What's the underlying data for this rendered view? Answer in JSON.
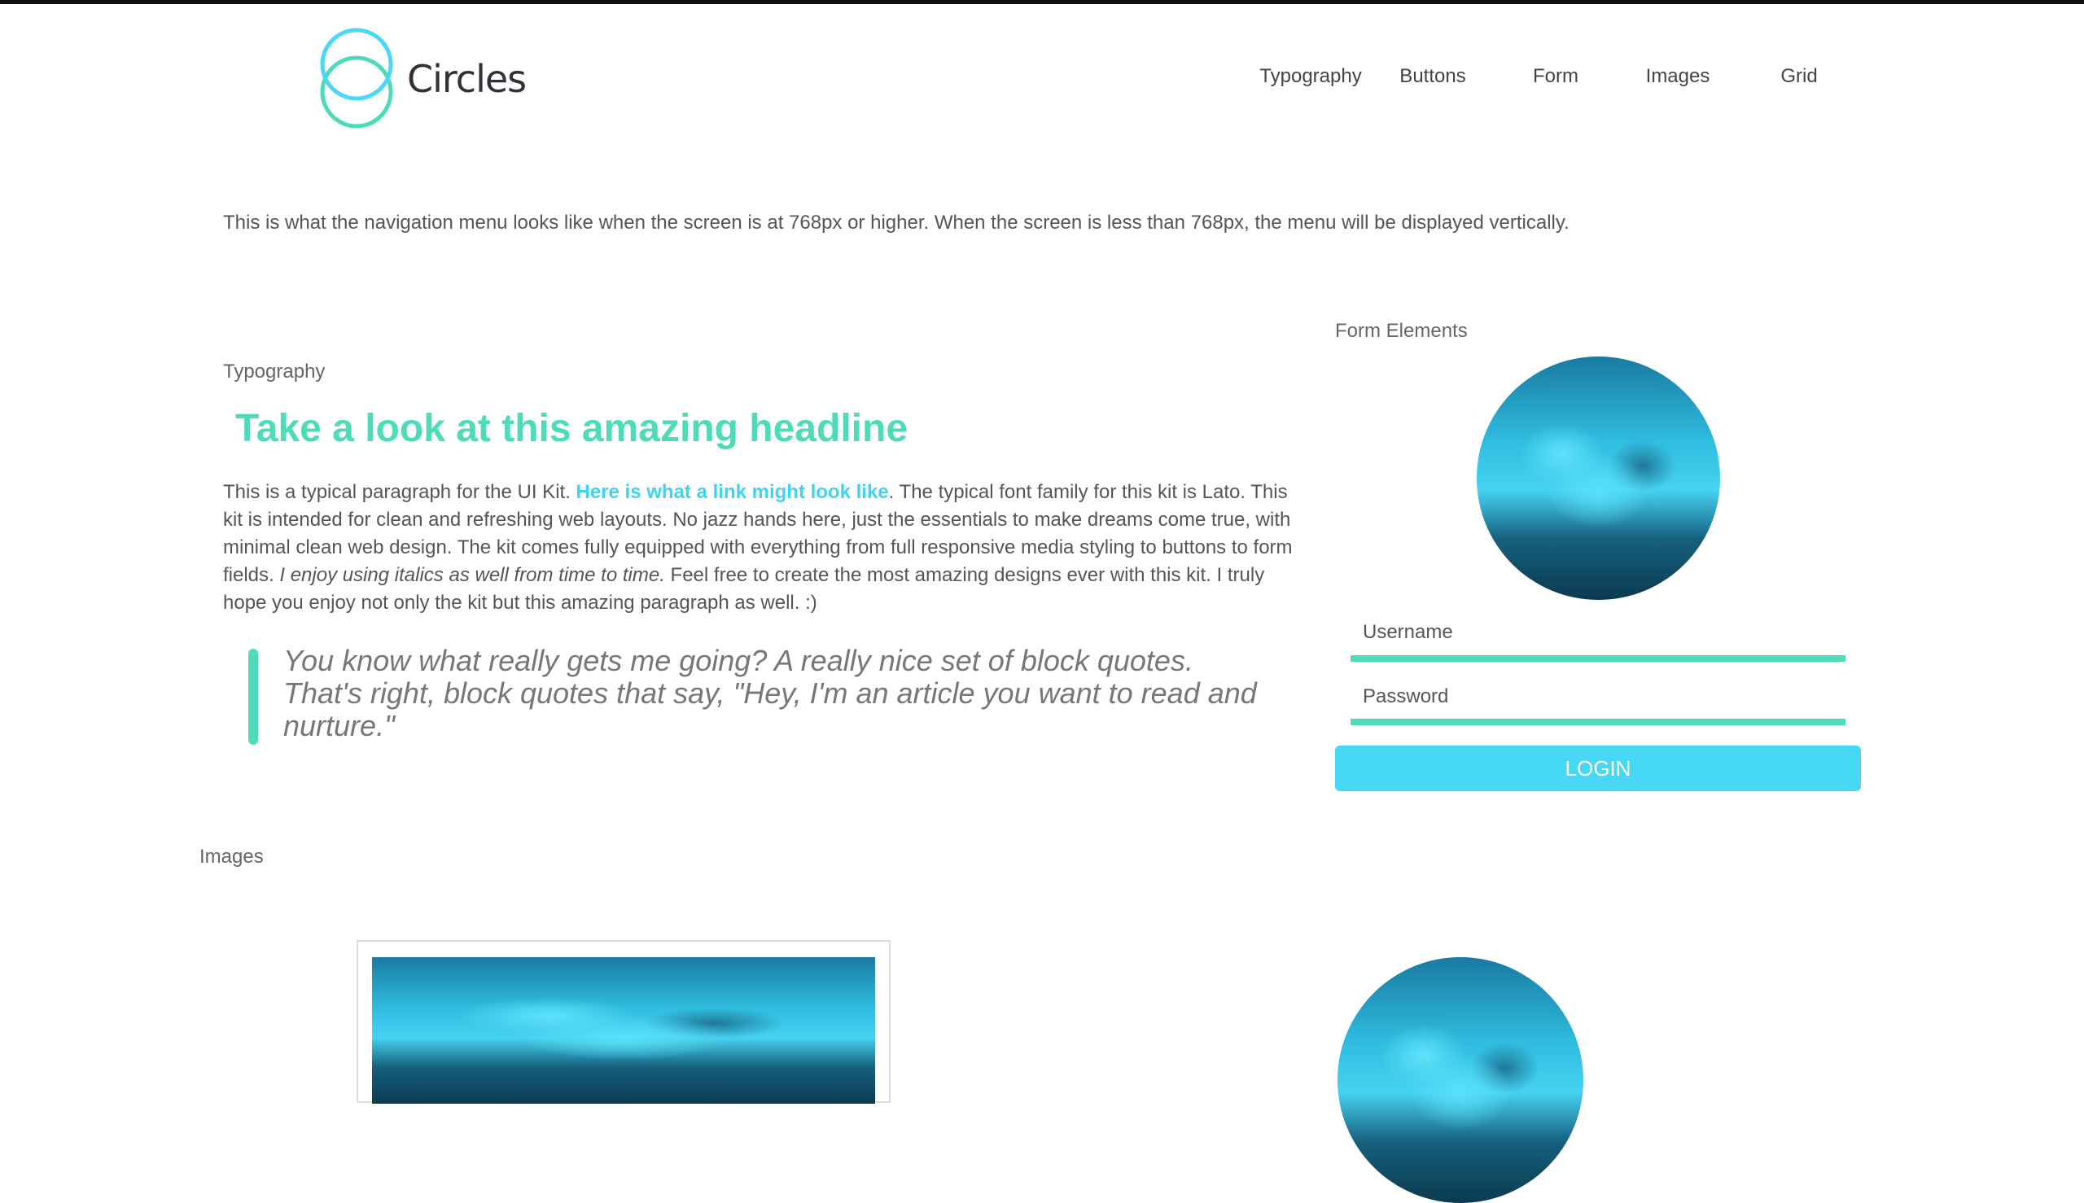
{
  "header": {
    "brand": "Circles",
    "colors": {
      "ring_top": "#4ad8f8",
      "ring_bottom": "#4ddbb9"
    },
    "nav": [
      "Typography",
      "Buttons",
      "Form",
      "Images",
      "Grid"
    ]
  },
  "intro": "This is what the navigation menu looks like when the screen is at 768px or higher. When the screen is less than 768px, the menu will be displayed vertically.",
  "typography": {
    "label": "Typography",
    "headline": "Take a look at this amazing headline",
    "para_1": "This is a typical paragraph for the UI Kit. ",
    "link": "Here is what a link might look like",
    "para_2": ". The typical font family for this kit is Lato. This kit is intended for clean and refreshing web layouts. No jazz hands here, just the essentials to make dreams come true, with minimal clean web design. The kit comes fully equipped with everything from full responsive media styling to buttons to form fields. ",
    "italic": "I enjoy using italics as well from time to time.",
    "para_3": " Feel free to create the most amazing designs ever with this kit. I truly hope you enjoy not only the kit but this amazing paragraph as well. :)",
    "blockquote": "You know what really gets me going? A really nice set of block quotes. That's right, block quotes that say, \"Hey, I'm an article you want to read and nurture.\""
  },
  "form": {
    "label": "Form Elements",
    "username_placeholder": "Username",
    "password_placeholder": "Password",
    "login_label": "LOGIN"
  },
  "images": {
    "label": "Images"
  }
}
